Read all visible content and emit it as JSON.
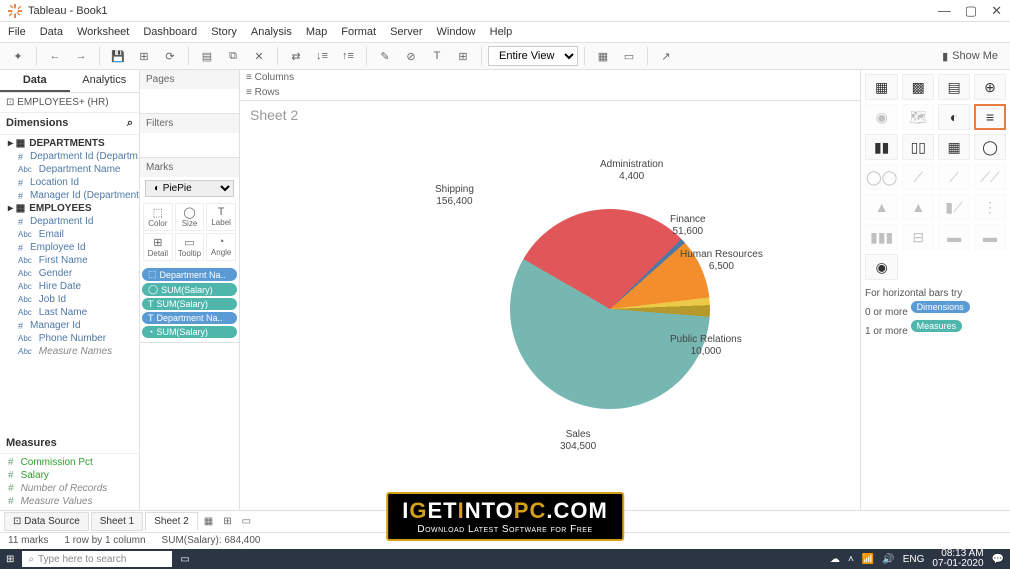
{
  "window": {
    "title": "Tableau - Book1"
  },
  "menu": [
    "File",
    "Data",
    "Worksheet",
    "Dashboard",
    "Story",
    "Analysis",
    "Map",
    "Format",
    "Server",
    "Window",
    "Help"
  ],
  "toolbar": {
    "view": "Entire View",
    "showme": "Show Me"
  },
  "dataTabs": {
    "data": "Data",
    "analytics": "Analytics"
  },
  "datasource": "EMPLOYEES+ (HR)",
  "dimensions": {
    "label": "Dimensions",
    "groups": [
      {
        "name": "DEPARTMENTS",
        "fields": [
          "Department Id (Departm...",
          "Department Name",
          "Location Id",
          "Manager Id (Departments)"
        ]
      },
      {
        "name": "EMPLOYEES",
        "fields": [
          "Department Id",
          "Email",
          "Employee Id",
          "First Name",
          "Gender",
          "Hire Date",
          "Job Id",
          "Last Name",
          "Manager Id",
          "Phone Number"
        ]
      }
    ],
    "extra": "Measure Names"
  },
  "measures": {
    "label": "Measures",
    "fields": [
      "Commission Pct",
      "Salary",
      "Number of Records",
      "Measure Values"
    ]
  },
  "shelves": {
    "pages": "Pages",
    "filters": "Filters",
    "marks": "Marks",
    "markType": "Pie",
    "cards": [
      "Color",
      "Size",
      "Label",
      "Detail",
      "Tooltip",
      "Angle"
    ],
    "pills": [
      {
        "label": "Department Na..",
        "cls": "blue"
      },
      {
        "label": "SUM(Salary)",
        "cls": "teal"
      },
      {
        "label": "SUM(Salary)",
        "cls": "teal"
      },
      {
        "label": "Department Na..",
        "cls": "blue"
      },
      {
        "label": "SUM(Salary)",
        "cls": "teal"
      }
    ]
  },
  "colrow": {
    "columns": "Columns",
    "rows": "Rows"
  },
  "sheetTitle": "Sheet 2",
  "chart_data": {
    "type": "pie",
    "title": "",
    "series": [
      {
        "name": "Shipping",
        "value": 156400,
        "color": "#e15759"
      },
      {
        "name": "Administration",
        "value": 4400,
        "color": "#4e79a7"
      },
      {
        "name": "Finance",
        "value": 51600,
        "color": "#f28e2b"
      },
      {
        "name": "Human Resources",
        "value": 6500,
        "color": "#edc948"
      },
      {
        "name": "Public Relations",
        "value": 10000,
        "color": "#b6992d"
      },
      {
        "name": "Sales",
        "value": 304500,
        "color": "#76b7b2"
      }
    ]
  },
  "showmeHint": {
    "intro": "For horizontal bars try",
    "line1": "0 or more",
    "pill1": "Dimensions",
    "line2": "1 or more",
    "pill2": "Measures"
  },
  "sheetTabs": {
    "datasource": "Data Source",
    "sheets": [
      "Sheet 1",
      "Sheet 2"
    ],
    "active": 1
  },
  "status": {
    "marks": "11 marks",
    "rows": "1 row by 1 column",
    "sum": "SUM(Salary): 684,400"
  },
  "taskbar": {
    "search": "Type here to search",
    "lang": "ENG",
    "time": "08:13 AM",
    "date": "07-01-2020"
  },
  "watermark": {
    "brand_pre": "I",
    "brand_g1": "G",
    "brand_mid1": "ET",
    "brand_g2": "I",
    "brand_mid2": "NTO",
    "brand_g3": "PC",
    "brand_suf": ".COM",
    "tag": "Download Latest Software for Free"
  }
}
